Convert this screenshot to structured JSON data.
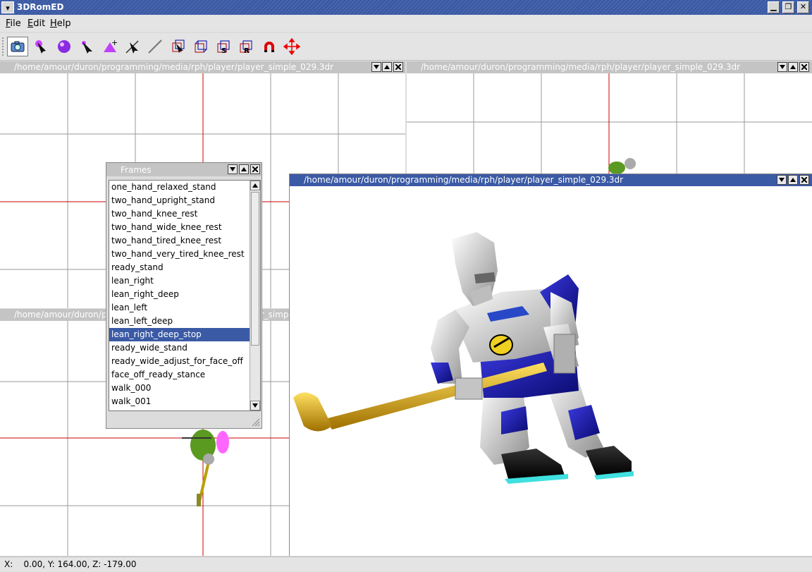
{
  "app": {
    "title": "3DRomED"
  },
  "menu": {
    "file": "File",
    "edit": "Edit",
    "help": "Help"
  },
  "toolbar": {
    "tools": [
      "camera-icon",
      "select-pointer-icon",
      "sphere-icon",
      "pointer-icon",
      "add-vertex-icon",
      "wand-pointer-icon",
      "line-icon",
      "box-select-icon",
      "box-icon",
      "scale-box-icon",
      "rotate-box-icon",
      "magnet-icon",
      "move-arrows-icon"
    ],
    "scale_letter": "S",
    "rotate_letter": "R"
  },
  "viewports": {
    "top_left": {
      "path": "/home/amour/duron/programming/media/rph/player/player_simple_029.3dr"
    },
    "top_right": {
      "path": "/home/amour/duron/programming/media/rph/player/player_simple_029.3dr"
    },
    "bottom_left": {
      "path": "/home/amour/duron/programming/media/rph/player/player_simple_029.3dr"
    },
    "perspective": {
      "path": "/home/amour/duron/programming/media/rph/player/player_simple_029.3dr"
    }
  },
  "frames": {
    "title": "Frames",
    "selected": "lean_right_deep_stop",
    "items": [
      "one_hand_relaxed_stand",
      "two_hand_upright_stand",
      "two_hand_knee_rest",
      "two_hand_wide_knee_rest",
      "two_hand_tired_knee_rest",
      "two_hand_very_tired_knee_rest",
      "ready_stand",
      "lean_right",
      "lean_right_deep",
      "lean_left",
      "lean_left_deep",
      "lean_right_deep_stop",
      "ready_wide_stand",
      "ready_wide_adjust_for_face_off",
      "face_off_ready_stance",
      "walk_000",
      "walk_001"
    ]
  },
  "status": {
    "coords": "X:    0.00, Y: 164.00, Z: -179.00"
  }
}
